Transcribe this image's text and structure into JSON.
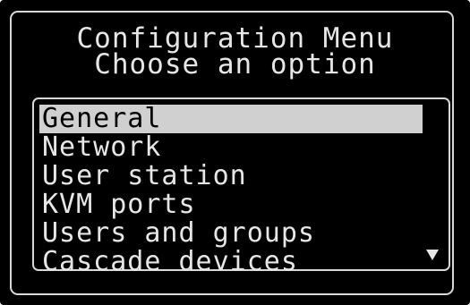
{
  "screen": {
    "title": "Configuration Menu",
    "subtitle": "Choose an option"
  },
  "menu": {
    "items": [
      {
        "label": "General",
        "selected": true
      },
      {
        "label": "Network",
        "selected": false
      },
      {
        "label": "User station",
        "selected": false
      },
      {
        "label": "KVM ports",
        "selected": false
      },
      {
        "label": "Users and groups",
        "selected": false
      },
      {
        "label": "Cascade devices",
        "selected": false
      }
    ],
    "scroll_indicator_icon": "triangle-down-icon"
  },
  "colors": {
    "background": "#000000",
    "text": "#e6e6e6",
    "frame": "#d8d8d8",
    "highlight": "#d0d0d0",
    "highlight_text": "#000000"
  }
}
